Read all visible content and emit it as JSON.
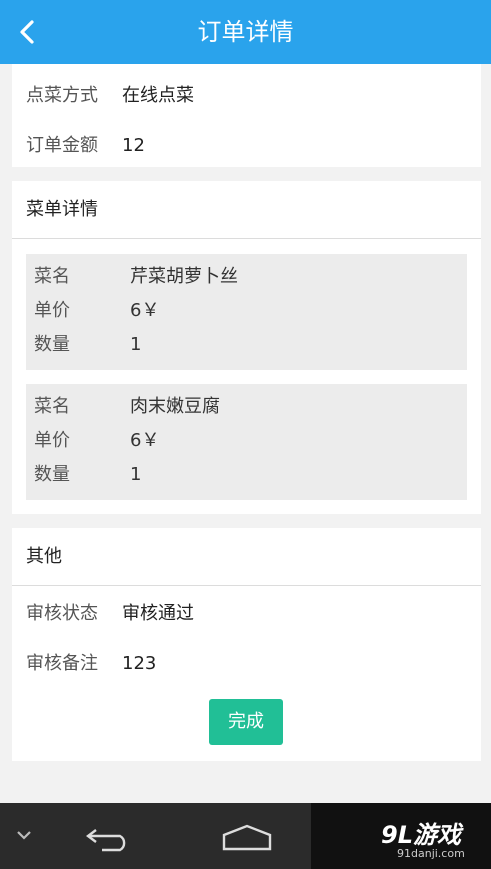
{
  "header": {
    "title": "订单详情",
    "back_icon": "chevron-left-icon"
  },
  "order_summary": {
    "method_label": "点菜方式",
    "method_value": "在线点菜",
    "amount_label": "订单金额",
    "amount_value": "12"
  },
  "menu_section": {
    "title": "菜单详情",
    "dishes": [
      {
        "name_label": "菜名",
        "name": "芹菜胡萝卜丝",
        "price_label": "单价",
        "price": "6￥",
        "qty_label": "数量",
        "qty": "1"
      },
      {
        "name_label": "菜名",
        "name": "肉末嫩豆腐",
        "price_label": "单价",
        "price": "6￥",
        "qty_label": "数量",
        "qty": "1"
      }
    ]
  },
  "other_section": {
    "title": "其他",
    "status_label": "审核状态",
    "status_value": "审核通过",
    "remark_label": "审核备注",
    "remark_value": "123",
    "done_button": "完成"
  },
  "nav": {
    "items": [
      "chevron-down-icon",
      "back-arrow-icon",
      "home-icon"
    ]
  },
  "watermark": {
    "logo_text": "9L游戏",
    "url": "91danji.com"
  },
  "colors": {
    "header": "#2aa3ec",
    "button": "#21bf96",
    "navbar": "#2b2b2b"
  }
}
